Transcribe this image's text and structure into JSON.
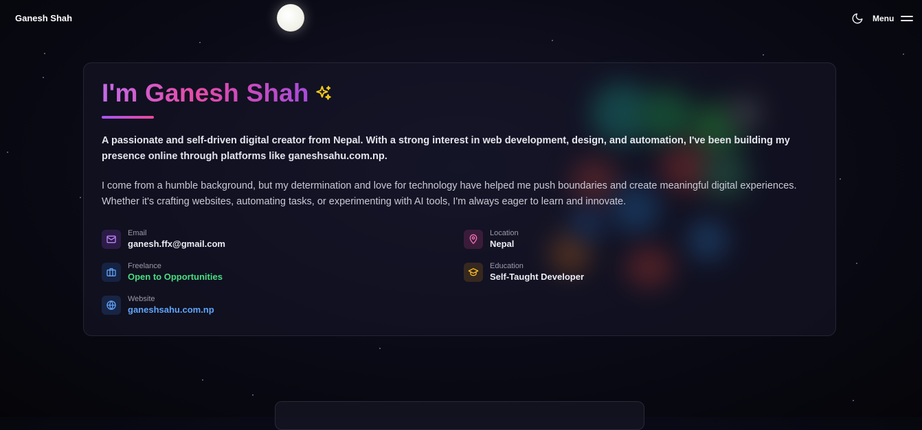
{
  "header": {
    "brand": "Ganesh Shah",
    "menu_label": "Menu"
  },
  "hero": {
    "title": "I'm Ganesh Shah",
    "lead": "A passionate and self-driven digital creator from Nepal. With a strong interest in web development, design, and automation, I've been building my presence online through platforms like ganeshsahu.com.np.",
    "body": "I come from a humble background, but my determination and love for technology have helped me push boundaries and create meaningful digital experiences. Whether it's crafting websites, automating tasks, or experimenting with AI tools, I'm always eager to learn and innovate."
  },
  "info": {
    "email": {
      "label": "Email",
      "value": "ganesh.ffx@gmail.com",
      "icon": "mail-icon",
      "color": "#a855f7"
    },
    "location": {
      "label": "Location",
      "value": "Nepal",
      "icon": "map-pin-icon",
      "color": "#ec4899"
    },
    "freelance": {
      "label": "Freelance",
      "value": "Open to Opportunities",
      "icon": "briefcase-icon",
      "color": "#4ade80"
    },
    "education": {
      "label": "Education",
      "value": "Self-Taught Developer",
      "icon": "graduation-cap-icon",
      "color": "#f59e0b"
    },
    "website": {
      "label": "Website",
      "value": "ganeshsahu.com.np",
      "icon": "globe-icon",
      "color": "#60a5fa"
    }
  },
  "colors": {
    "accent_purple": "#a855f7",
    "accent_pink": "#ec4899",
    "sparkle": "#facc15"
  }
}
